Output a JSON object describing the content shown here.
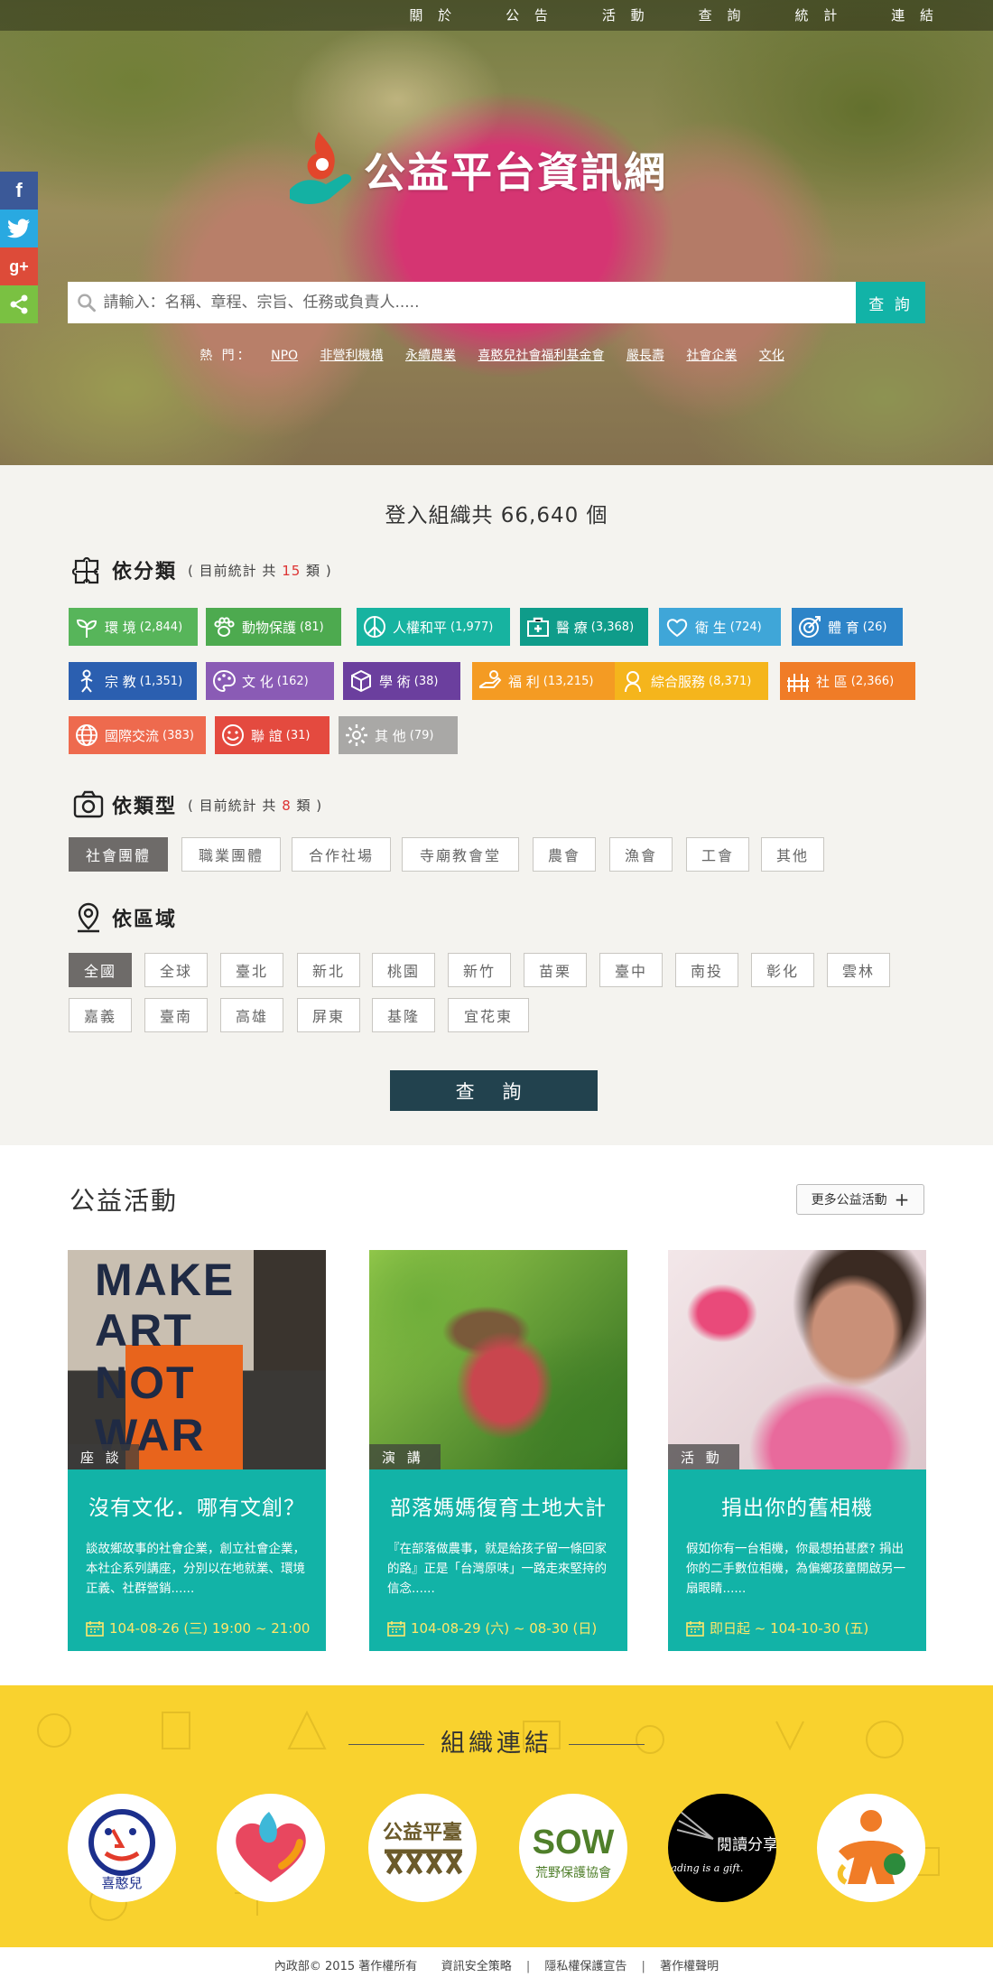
{
  "nav": {
    "items": [
      "關 於",
      "公 告",
      "活 動",
      "查 詢",
      "統 計",
      "連 結"
    ]
  },
  "social": {
    "facebook": "f",
    "google": "g+"
  },
  "hero": {
    "title": "公益平台資訊網",
    "search_placeholder": "請輸入：名稱、章程、宗旨、任務或負責人.....",
    "search_button": "查 詢",
    "hot_label": "熱 門：",
    "hot_links": [
      "NPO",
      "非營利機構",
      "永續農業",
      "喜憨兒社會福利基金會",
      "嚴長壽",
      "社會企業",
      "文化"
    ]
  },
  "stats": {
    "summary": "登入組織共 66,640 個"
  },
  "category_section": {
    "title": "依分類",
    "note_prefix": "( 目前統計 共 ",
    "note_count": "15",
    "note_suffix": " 類 )",
    "items": [
      {
        "label": "環 境",
        "count": "(2,844)",
        "color": "#57b55a",
        "icon": "sprout-icon"
      },
      {
        "label": "動物保護",
        "count": "(81)",
        "color": "#4daa4f",
        "icon": "paw-icon"
      },
      {
        "label": "人權和平",
        "count": "(1,977)",
        "color": "#17b3a0",
        "icon": "peace-icon"
      },
      {
        "label": "醫 療",
        "count": "(3,368)",
        "color": "#0f9c8a",
        "icon": "medical-kit-icon"
      },
      {
        "label": "衛 生",
        "count": "(724)",
        "color": "#3fa6d8",
        "icon": "heart-hand-icon"
      },
      {
        "label": "體 育",
        "count": "(26)",
        "color": "#2d84c8",
        "icon": "target-icon"
      },
      {
        "label": "宗 教",
        "count": "(1,351)",
        "color": "#2b5fb0",
        "icon": "person-pray-icon"
      },
      {
        "label": "文 化",
        "count": "(162)",
        "color": "#8a5bb5",
        "icon": "palette-icon"
      },
      {
        "label": "學 術",
        "count": "(38)",
        "color": "#6b3f9e",
        "icon": "cube-icon"
      },
      {
        "label": "福 利",
        "count": "(13,215)",
        "color": "#f49b23",
        "icon": "hand-money-icon"
      },
      {
        "label": "綜合服務",
        "count": "(8,371)",
        "color": "#f5b51c",
        "icon": "service-icon"
      },
      {
        "label": "社 區",
        "count": "(2,366)",
        "color": "#f07c27",
        "icon": "community-icon"
      },
      {
        "label": "國際交流",
        "count": "(383)",
        "color": "#ee6a4e",
        "icon": "globe-icon"
      },
      {
        "label": "聯 誼",
        "count": "(31)",
        "color": "#e44a3f",
        "icon": "smile-icon"
      },
      {
        "label": "其 他",
        "count": "(79)",
        "color": "#a9a8a6",
        "icon": "gear-icon"
      }
    ]
  },
  "type_section": {
    "title": "依類型",
    "note_prefix": "( 目前統計 共 ",
    "note_count": "8",
    "note_suffix": " 類 )",
    "items": [
      "社會團體",
      "職業團體",
      "合作社場",
      "寺廟教會堂",
      "農會",
      "漁會",
      "工會",
      "其他"
    ],
    "selected": "社會團體"
  },
  "region_section": {
    "title": "依區域",
    "items": [
      "全國",
      "全球",
      "臺北",
      "新北",
      "桃園",
      "新竹",
      "苗栗",
      "臺中",
      "南投",
      "彰化",
      "雲林",
      "嘉義",
      "臺南",
      "高雄",
      "屏東",
      "基隆",
      "宜花東"
    ],
    "selected": "全國"
  },
  "query_button": "查 詢",
  "events": {
    "title": "公益活動",
    "more_label": "更多公益活動",
    "cards": [
      {
        "tag": "座 談",
        "title": "沒有文化．哪有文創？",
        "desc": "談故鄉故事的社會企業，創立社會企業，本社企系列講座，分別以在地就業、環境正義、社群營銷......",
        "date": "104-08-26 (三) 19:00 ~ 21:00",
        "poster_words": [
          "MAKE",
          "ART",
          "NOT",
          "WAR"
        ]
      },
      {
        "tag": "演 講",
        "title": "部落媽媽復育土地大計",
        "desc": "『在部落做農事，就是給孩子留一條回家的路』正是「台灣原味」一路走來堅持的信念......",
        "date": "104-08-29 (六) ~ 08-30 (日)"
      },
      {
        "tag": "活 動",
        "title": "捐出你的舊相機",
        "desc": "假如你有一台相機，你最想拍甚麼? 捐出你的二手數位相機，為偏鄉孩童開啟另一扇眼睛......",
        "date": "即日起 ~ 104-10-30 (五)"
      }
    ]
  },
  "partners": {
    "title": "組織連結",
    "logos": [
      {
        "name": "喜憨兒",
        "caption": "喜憨兒"
      },
      {
        "name": "heart-hands-logo"
      },
      {
        "name": "公益平臺",
        "caption": "公益平臺"
      },
      {
        "name": "荒野保護協會",
        "caption": "SOW",
        "subcaption": "荒野保護協會"
      },
      {
        "name": "閱讀分享",
        "caption": "閱讀分享",
        "subcaption": "Reading is a gift."
      },
      {
        "name": "people-logo"
      }
    ]
  },
  "footer": {
    "copyright": "內政部© 2015 著作權所有",
    "links": [
      "資訊安全策略",
      "隱私權保護宣告",
      "著作權聲明"
    ]
  }
}
